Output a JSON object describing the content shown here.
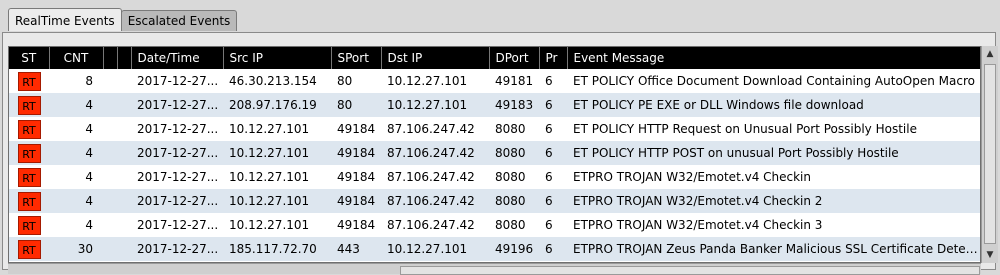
{
  "tabs": [
    {
      "label": "RealTime Events",
      "active": true
    },
    {
      "label": "Escalated Events",
      "active": false
    }
  ],
  "table": {
    "columns": [
      "ST",
      "CNT",
      "",
      "",
      "Date/Time",
      "Src IP",
      "SPort",
      "Dst IP",
      "DPort",
      "Pr",
      "Event Message"
    ],
    "rows": [
      {
        "st": "RT",
        "cnt": "8",
        "datetime": "2017-12-27...",
        "src_ip": "46.30.213.154",
        "sport": "80",
        "dst_ip": "10.12.27.101",
        "dport": "49181",
        "pr": "6",
        "msg": "ET POLICY Office Document Download Containing AutoOpen Macro"
      },
      {
        "st": "RT",
        "cnt": "4",
        "datetime": "2017-12-27...",
        "src_ip": "208.97.176.19",
        "sport": "80",
        "dst_ip": "10.12.27.101",
        "dport": "49183",
        "pr": "6",
        "msg": "ET POLICY PE EXE or DLL Windows file download"
      },
      {
        "st": "RT",
        "cnt": "4",
        "datetime": "2017-12-27...",
        "src_ip": "10.12.27.101",
        "sport": "49184",
        "dst_ip": "87.106.247.42",
        "dport": "8080",
        "pr": "6",
        "msg": "ET POLICY HTTP Request on Unusual Port Possibly Hostile"
      },
      {
        "st": "RT",
        "cnt": "4",
        "datetime": "2017-12-27...",
        "src_ip": "10.12.27.101",
        "sport": "49184",
        "dst_ip": "87.106.247.42",
        "dport": "8080",
        "pr": "6",
        "msg": "ET POLICY HTTP POST on unusual Port Possibly Hostile"
      },
      {
        "st": "RT",
        "cnt": "4",
        "datetime": "2017-12-27...",
        "src_ip": "10.12.27.101",
        "sport": "49184",
        "dst_ip": "87.106.247.42",
        "dport": "8080",
        "pr": "6",
        "msg": "ETPRO TROJAN W32/Emotet.v4 Checkin"
      },
      {
        "st": "RT",
        "cnt": "4",
        "datetime": "2017-12-27...",
        "src_ip": "10.12.27.101",
        "sport": "49184",
        "dst_ip": "87.106.247.42",
        "dport": "8080",
        "pr": "6",
        "msg": "ETPRO TROJAN W32/Emotet.v4 Checkin 2"
      },
      {
        "st": "RT",
        "cnt": "4",
        "datetime": "2017-12-27...",
        "src_ip": "10.12.27.101",
        "sport": "49184",
        "dst_ip": "87.106.247.42",
        "dport": "8080",
        "pr": "6",
        "msg": "ETPRO TROJAN W32/Emotet.v4 Checkin 3"
      },
      {
        "st": "RT",
        "cnt": "30",
        "datetime": "2017-12-27...",
        "src_ip": "185.117.72.70",
        "sport": "443",
        "dst_ip": "10.12.27.101",
        "dport": "49196",
        "pr": "6",
        "msg": "ETPRO TROJAN Zeus Panda Banker Malicious SSL Certificate Detec..."
      }
    ]
  },
  "icons": {
    "scroll_up": "up-arrow-icon",
    "scroll_down": "down-arrow-icon"
  },
  "colors": {
    "rt_badge": "#ff2a00",
    "header_bg": "#000000",
    "row_alt": "#dde6ef"
  }
}
